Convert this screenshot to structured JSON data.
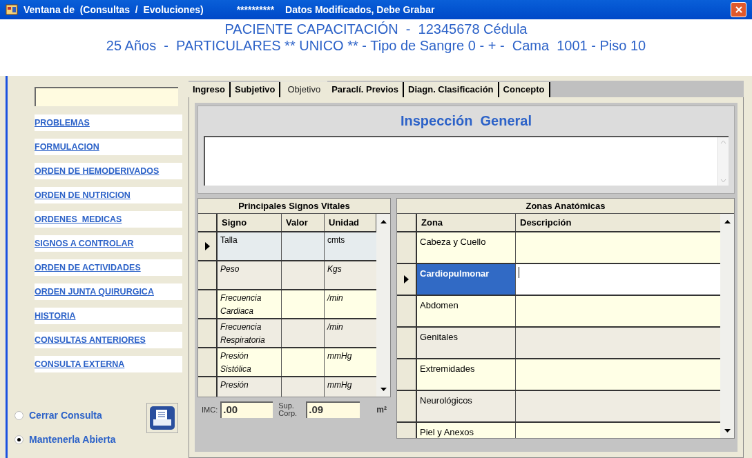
{
  "window": {
    "title": "Ventana de  (Consultas  /  Evoluciones)",
    "notice": "**********",
    "notice_text": "Datos Modificados, Debe Grabar"
  },
  "header": {
    "line_1": "PACIENTE CAPACITACIÓN  -  12345678 Cédula",
    "line_2": "25 Años  -  PARTICULARES ** UNICO ** - Tipo de Sangre 0 - + -  Cama  1001 - Piso 10"
  },
  "sidebar": {
    "links": [
      "PROBLEMAS",
      "FORMULACION",
      "ORDEN DE HEMODERIVADOS",
      "ORDEN DE NUTRICION",
      "ORDENES  MEDICAS",
      "SIGNOS A CONTROLAR",
      "ORDEN DE ACTIVIDADES",
      "ORDEN JUNTA QUIRURGICA",
      "HISTORIA",
      "CONSULTAS ANTERIORES",
      "CONSULTA EXTERNA"
    ],
    "options": [
      {
        "label": "Cerrar Consulta",
        "selected": false
      },
      {
        "label": "Mantenerla Abierta",
        "selected": true
      }
    ]
  },
  "tabs": [
    {
      "label": "Ingreso",
      "selected": false
    },
    {
      "label": "Subjetivo",
      "selected": false
    },
    {
      "label": "Objetivo",
      "selected": true
    },
    {
      "label": "Paraclí. Previos",
      "selected": false
    },
    {
      "label": "Diagn. Clasificación",
      "selected": false
    },
    {
      "label": "Concepto",
      "selected": false
    }
  ],
  "inspection": {
    "title": "Inspección  General"
  },
  "vitals": {
    "title": "Principales Signos Vitales",
    "columns": [
      "Signo",
      "Valor",
      "Unidad"
    ],
    "rows": [
      {
        "sign": "Talla",
        "unit": "cmts",
        "selected": true
      },
      {
        "sign": "Peso",
        "unit": "Kgs",
        "selected": false
      },
      {
        "sign": "Frecuencia Cardiaca",
        "unit": "/min",
        "selected": false
      },
      {
        "sign": "Frecuencia Respiratoria",
        "unit": "/min",
        "selected": false
      },
      {
        "sign": "Presión Sistólica",
        "unit": "mmHg",
        "selected": false
      },
      {
        "sign": "Presión",
        "unit": "mmHg",
        "selected": false
      }
    ],
    "imc_label": "IMC:",
    "imc": ".00",
    "sup_label": "Sup. Corp.",
    "sup": ".09",
    "sup_unit": "m²"
  },
  "zones": {
    "title": "Zonas Anatómicas",
    "columns": [
      "Zona",
      "Descripción"
    ],
    "rows": [
      {
        "zone": "Cabeza y Cuello",
        "selected": false
      },
      {
        "zone": "Cardiopulmonar",
        "selected": true
      },
      {
        "zone": "Abdomen",
        "selected": false
      },
      {
        "zone": "Genitales",
        "selected": false
      },
      {
        "zone": "Extremidades",
        "selected": false
      },
      {
        "zone": "Neurológicos",
        "selected": false
      },
      {
        "zone": "Piel y Anexos",
        "selected": false
      }
    ]
  }
}
